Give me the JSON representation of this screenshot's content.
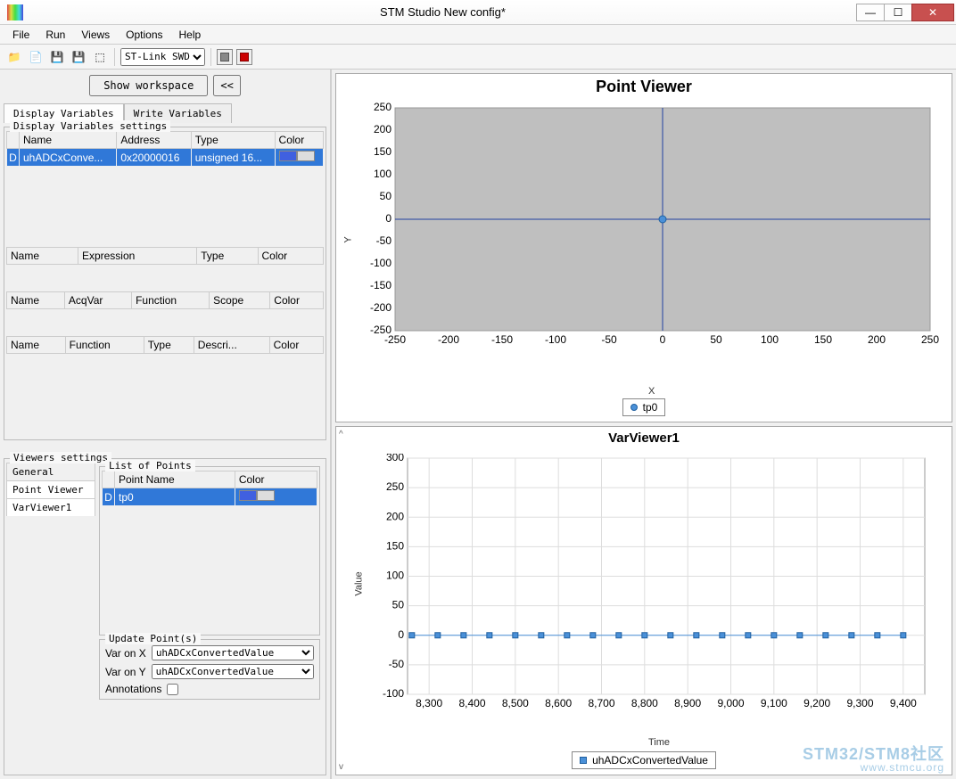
{
  "window": {
    "title": "STM Studio New config*"
  },
  "menu": {
    "file": "File",
    "run": "Run",
    "views": "Views",
    "options": "Options",
    "help": "Help"
  },
  "toolbar": {
    "connection": "ST-Link SWD"
  },
  "workspace": {
    "show": "Show workspace",
    "collapse": "<<"
  },
  "tabs": {
    "display": "Display Variables",
    "write": "Write Variables"
  },
  "displayVars": {
    "legend": "Display Variables settings",
    "headers": {
      "name": "Name",
      "address": "Address",
      "type": "Type",
      "color": "Color"
    },
    "rows": [
      {
        "badge": "D",
        "name": "uhADCxConve...",
        "address": "0x20000016",
        "type": "unsigned 16...",
        "color": "#4060e0"
      }
    ]
  },
  "exprGrid": {
    "headers": {
      "name": "Name",
      "expression": "Expression",
      "type": "Type",
      "color": "Color"
    }
  },
  "acqGrid": {
    "headers": {
      "name": "Name",
      "acqvar": "AcqVar",
      "function": "Function",
      "scope": "Scope",
      "color": "Color"
    }
  },
  "funcGrid": {
    "headers": {
      "name": "Name",
      "function": "Function",
      "type": "Type",
      "descri": "Descri...",
      "color": "Color"
    }
  },
  "viewers": {
    "legend": "Viewers settings",
    "vtabs": {
      "general": "General",
      "pv": "Point Viewer",
      "vv": "VarViewer1"
    },
    "listLegend": "List of Points",
    "listHeaders": {
      "pointName": "Point Name",
      "color": "Color"
    },
    "points": [
      {
        "badge": "D",
        "name": "tp0",
        "color": "#4060e0"
      }
    ],
    "updateLegend": "Update Point(s)",
    "varOnX": "Var on X",
    "varOnY": "Var on Y",
    "varValue": "uhADCxConvertedValue",
    "annotations": "Annotations"
  },
  "pointViewer": {
    "title": "Point Viewer",
    "xlabel": "X",
    "ylabel": "Y",
    "legend": "tp0"
  },
  "varViewer": {
    "title": "VarViewer1",
    "xlabel": "Time",
    "ylabel": "Value",
    "legend": "uhADCxConvertedValue"
  },
  "chart_data": [
    {
      "type": "scatter",
      "title": "Point Viewer",
      "xlabel": "X",
      "ylabel": "Y",
      "xlim": [
        -250,
        250
      ],
      "ylim": [
        -250,
        250
      ],
      "xticks": [
        -250,
        -200,
        -150,
        -100,
        -50,
        0,
        50,
        100,
        150,
        200,
        250
      ],
      "yticks": [
        -250,
        -200,
        -150,
        -100,
        -50,
        0,
        50,
        100,
        150,
        200,
        250
      ],
      "series": [
        {
          "name": "tp0",
          "x": [
            0
          ],
          "y": [
            0
          ]
        }
      ]
    },
    {
      "type": "line",
      "title": "VarViewer1",
      "xlabel": "Time",
      "ylabel": "Value",
      "xlim": [
        8250,
        9450
      ],
      "ylim": [
        -100,
        300
      ],
      "xticks": [
        8300,
        8400,
        8500,
        8600,
        8700,
        8800,
        8900,
        9000,
        9100,
        9200,
        9300,
        9400
      ],
      "yticks": [
        -100,
        -50,
        0,
        50,
        100,
        150,
        200,
        250,
        300
      ],
      "series": [
        {
          "name": "uhADCxConvertedValue",
          "x": [
            8260,
            8320,
            8380,
            8440,
            8500,
            8560,
            8620,
            8680,
            8740,
            8800,
            8860,
            8920,
            8980,
            9040,
            9100,
            9160,
            9220,
            9280,
            9340,
            9400
          ],
          "y": [
            0,
            0,
            0,
            0,
            0,
            0,
            0,
            0,
            0,
            0,
            0,
            0,
            0,
            0,
            0,
            0,
            0,
            0,
            0,
            0
          ]
        }
      ]
    }
  ]
}
